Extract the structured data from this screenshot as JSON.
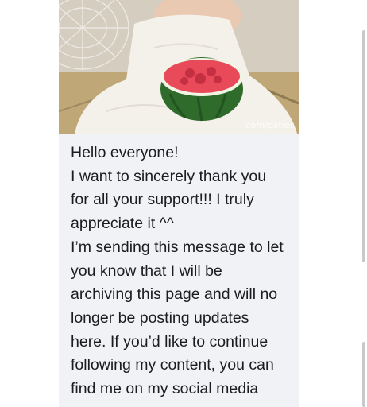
{
  "photo": {
    "watermark": "com/caties"
  },
  "message": {
    "lines": [
      "Hello everyone!",
      "I want to sincerely thank you",
      "for all your support!!! I truly",
      "appreciate it ^^",
      "I’m sending this message to let",
      "you know that I will be",
      "archiving this page and will no",
      "longer be posting updates",
      "here. If you’d like to continue",
      "following my content, you can",
      "find me on my social media"
    ]
  },
  "colors": {
    "bubble_background": "#f1f2f5",
    "text": "#1c1c1e",
    "scrollbar": "#c9c9cc"
  }
}
